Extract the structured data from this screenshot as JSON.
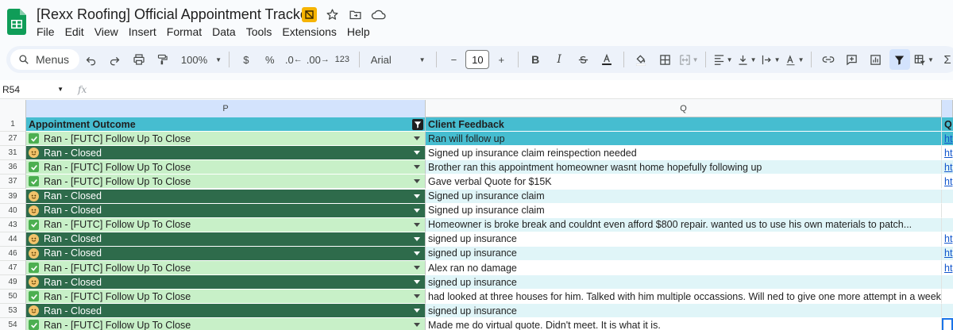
{
  "title_bar": {
    "doc_title": "[Rexx Roofing] Official Appointment Tracker",
    "menu": [
      "File",
      "Edit",
      "View",
      "Insert",
      "Format",
      "Data",
      "Tools",
      "Extensions",
      "Help"
    ]
  },
  "toolbar": {
    "menus_label": "Menus",
    "zoom": "100%",
    "currency": "$",
    "percent": "%",
    "decrease_decimal": ".0",
    "increase_decimal": ".00",
    "number_format": "123",
    "font": "Arial",
    "font_size": "10",
    "minus": "−",
    "plus": "+",
    "bold": "B",
    "italic": "I",
    "sigma": "Σ"
  },
  "formula_bar": {
    "cell_ref": "R54",
    "fx": "fx"
  },
  "columns": {
    "p": "P",
    "q": "Q"
  },
  "header": {
    "p": "Appointment Outcome",
    "q": "Client Feedback",
    "r": "Q"
  },
  "rows": [
    {
      "num": "27",
      "outcome": "Ran - [FUTC] Follow Up To Close",
      "kind": "futc",
      "feedback": "Ran will follow up",
      "q_style": "blue",
      "link": "ht"
    },
    {
      "num": "31",
      "outcome": "Ran - Closed",
      "kind": "closed",
      "feedback": "Signed up insurance claim reinspection needed",
      "q_style": "white",
      "link": "ht"
    },
    {
      "num": "36",
      "outcome": "Ran - [FUTC] Follow Up To Close",
      "kind": "futc",
      "feedback": "Brother ran this appointment homeowner wasnt home hopefully following up",
      "q_style": "light",
      "link": "ht"
    },
    {
      "num": "37",
      "outcome": "Ran - [FUTC] Follow Up To Close",
      "kind": "futc",
      "feedback": "Gave verbal Quote for $15K",
      "q_style": "white",
      "link": "ht"
    },
    {
      "num": "39",
      "outcome": "Ran - Closed",
      "kind": "closed",
      "feedback": "Signed up insurance claim",
      "q_style": "light",
      "link": ""
    },
    {
      "num": "40",
      "outcome": "Ran - Closed",
      "kind": "closed",
      "feedback": "Signed up insurance claim",
      "q_style": "white",
      "link": ""
    },
    {
      "num": "43",
      "outcome": "Ran - [FUTC] Follow Up To Close",
      "kind": "futc",
      "feedback": "Homeowner is broke break and couldnt even afford $800 repair.  wanted us to use his own materials to patch...",
      "q_style": "light",
      "link": ""
    },
    {
      "num": "44",
      "outcome": "Ran - Closed",
      "kind": "closed",
      "feedback": "signed up insurance",
      "q_style": "white",
      "link": "ht"
    },
    {
      "num": "46",
      "outcome": "Ran - Closed",
      "kind": "closed",
      "feedback": "signed up insurance",
      "q_style": "light",
      "link": "ht"
    },
    {
      "num": "47",
      "outcome": "Ran - [FUTC] Follow Up To Close",
      "kind": "futc",
      "feedback": "Alex ran no damage",
      "q_style": "white",
      "link": "ht"
    },
    {
      "num": "49",
      "outcome": "Ran - Closed",
      "kind": "closed",
      "feedback": "signed up insurance",
      "q_style": "light",
      "link": ""
    },
    {
      "num": "50",
      "outcome": "Ran - [FUTC] Follow Up To Close",
      "kind": "futc",
      "feedback": "had looked at three houses for him.  Talked with him multiple occassions.  Will ned to give one more attempt in a week or so",
      "q_style": "white",
      "link": ""
    },
    {
      "num": "53",
      "outcome": "Ran - Closed",
      "kind": "closed",
      "feedback": "signed up insurance",
      "q_style": "light",
      "link": ""
    },
    {
      "num": "54",
      "outcome": "Ran - [FUTC] Follow Up To Close",
      "kind": "futc",
      "feedback": "Made me do virtual quote. Didn't meet. It is what it is.",
      "q_style": "white",
      "link": ""
    }
  ],
  "colors": {
    "header_teal": "#46bdd0",
    "futc_green": "#c8f0c8",
    "closed_green": "#2e6b4b",
    "light_teal": "#e0f5f8",
    "sheets_green": "#0f9d58"
  }
}
